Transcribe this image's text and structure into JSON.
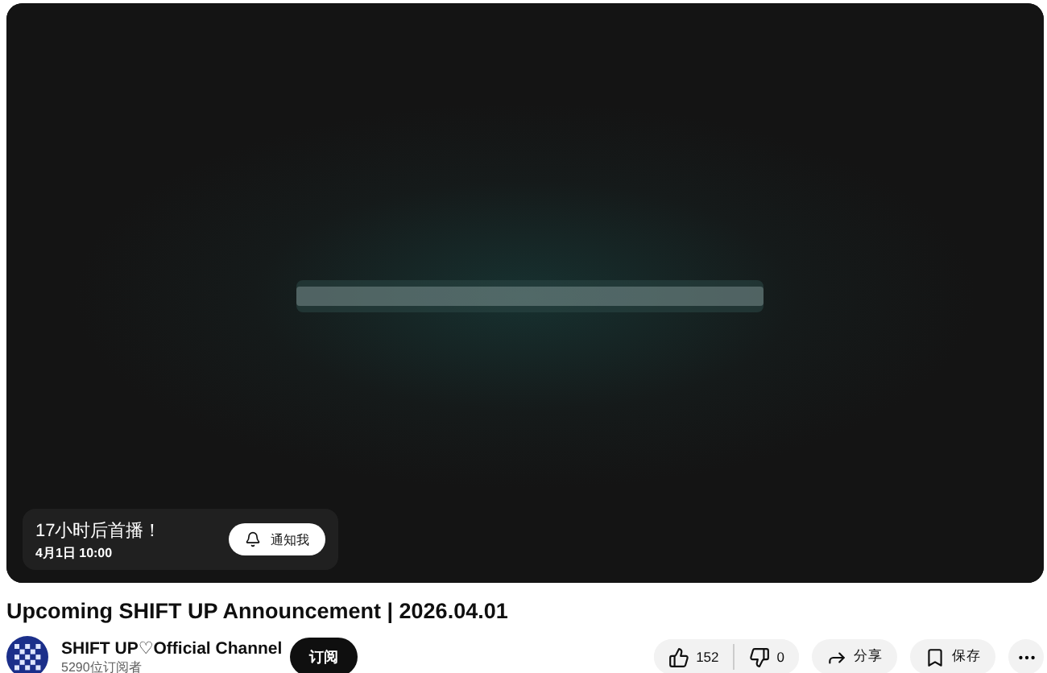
{
  "premiere": {
    "countdown": "17小时后首播！",
    "date": "4月1日 10:00",
    "notify_button": "通知我"
  },
  "video": {
    "title": "Upcoming SHIFT UP Announcement | 2026.04.01"
  },
  "channel": {
    "name": "SHIFT UP♡Official Channel",
    "subscribers": "5290位订阅者",
    "subscribe_button": "订阅"
  },
  "actions": {
    "likes": "152",
    "dislikes": "0",
    "share": "分享",
    "save": "保存"
  }
}
